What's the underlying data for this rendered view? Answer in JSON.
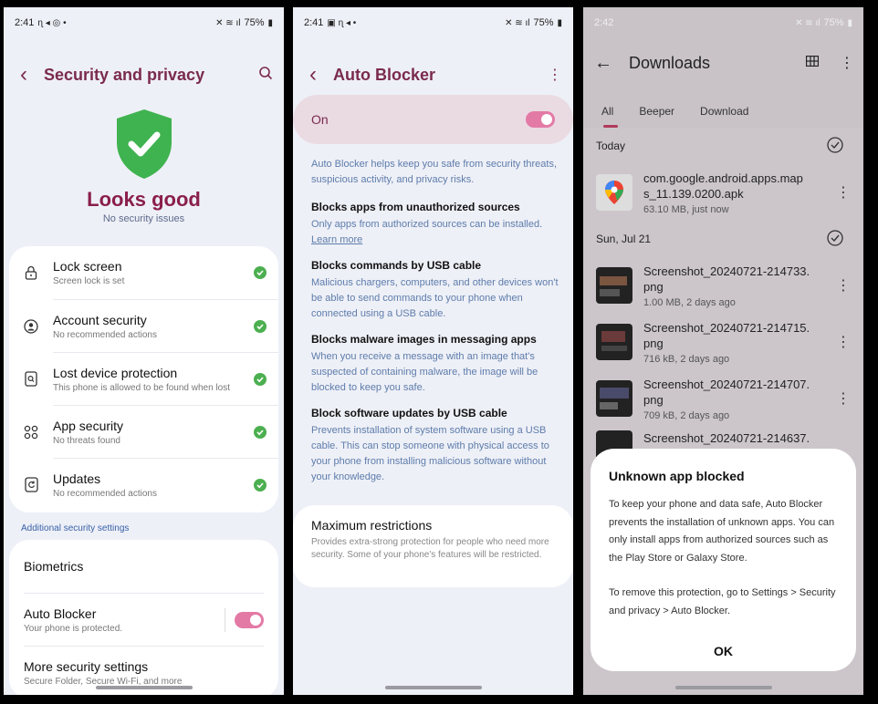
{
  "phones": [
    {
      "status": {
        "time": "2:41",
        "battery": "75%"
      },
      "header": {
        "title": "Security and privacy"
      },
      "hero": {
        "title": "Looks good",
        "subtitle": "No security issues"
      },
      "items": [
        {
          "title": "Lock screen",
          "sub": "Screen lock is set",
          "icon": "lock-icon"
        },
        {
          "title": "Account security",
          "sub": "No recommended actions",
          "icon": "account-icon"
        },
        {
          "title": "Lost device protection",
          "sub": "This phone is allowed to be found when lost",
          "icon": "find-device-icon"
        },
        {
          "title": "App security",
          "sub": "No threats found",
          "icon": "apps-icon"
        },
        {
          "title": "Updates",
          "sub": "No recommended actions",
          "icon": "update-icon"
        }
      ],
      "section_label": "Additional security settings",
      "more": [
        {
          "title": "Biometrics"
        },
        {
          "title": "Auto Blocker",
          "sub": "Your phone is protected."
        },
        {
          "title": "More security settings",
          "sub": "Secure Folder, Secure Wi-Fi, and more"
        }
      ]
    },
    {
      "status": {
        "time": "2:41",
        "battery": "75%"
      },
      "header": {
        "title": "Auto Blocker"
      },
      "on_label": "On",
      "intro": "Auto Blocker helps keep you safe from security threats, suspicious activity, and privacy risks.",
      "blocks": [
        {
          "title": "Blocks apps from unauthorized sources",
          "desc": "Only apps from authorized sources can be installed.",
          "link": "Learn more"
        },
        {
          "title": "Blocks commands by USB cable",
          "desc": "Malicious chargers, computers, and other devices won't be able to send commands to your phone when connected using a USB cable."
        },
        {
          "title": "Blocks malware images in messaging apps",
          "desc": "When you receive a message with an image that's suspected of containing malware, the image will be blocked to keep you safe."
        },
        {
          "title": "Block software updates by USB cable",
          "desc": "Prevents installation of system software using a USB cable. This can stop someone with physical access to your phone from installing malicious software without your knowledge."
        }
      ],
      "max": {
        "title": "Maximum restrictions",
        "desc": "Provides extra-strong protection for people who need more security. Some of your phone's features will be restricted."
      }
    },
    {
      "status": {
        "time": "2:42",
        "battery": "75%"
      },
      "header": {
        "title": "Downloads"
      },
      "tabs": [
        "All",
        "Beeper",
        "Download"
      ],
      "groups": [
        {
          "label": "Today",
          "files": [
            {
              "name": "com.google.android.apps.maps_11.139.0200.apk",
              "name_l1": "com.google.android.apps.map",
              "name_l2": "s_11.139.0200.apk",
              "meta": "63.10 MB, just now",
              "thumb": "maps-icon"
            }
          ]
        },
        {
          "label": "Sun, Jul 21",
          "files": [
            {
              "name_l1": "Screenshot_20240721-214733.",
              "name_l2": "png",
              "meta": "1.00 MB, 2 days ago",
              "thumb": "screenshot-thumb"
            },
            {
              "name_l1": "Screenshot_20240721-214715.",
              "name_l2": "png",
              "meta": "716 kB, 2 days ago",
              "thumb": "screenshot-thumb"
            },
            {
              "name_l1": "Screenshot_20240721-214707.",
              "name_l2": "png",
              "meta": "709 kB, 2 days ago",
              "thumb": "screenshot-thumb"
            },
            {
              "name_l1": "Screenshot_20240721-214637.",
              "name_l2": "",
              "meta": "",
              "thumb": "screenshot-thumb"
            }
          ]
        }
      ],
      "dialog": {
        "title": "Unknown app blocked",
        "body1": "To keep your phone and data safe, Auto Blocker prevents the installation of unknown apps. You can only install apps from authorized sources such as the Play Store or Galaxy Store.",
        "body2": "To remove this protection, go to Settings > Security and privacy > Auto Blocker.",
        "ok": "OK"
      }
    }
  ],
  "colors": {
    "accent": "#7a2a4f",
    "check_green": "#4caf50",
    "toggle": "#e37aa6",
    "link_blue": "#5d7cab"
  }
}
